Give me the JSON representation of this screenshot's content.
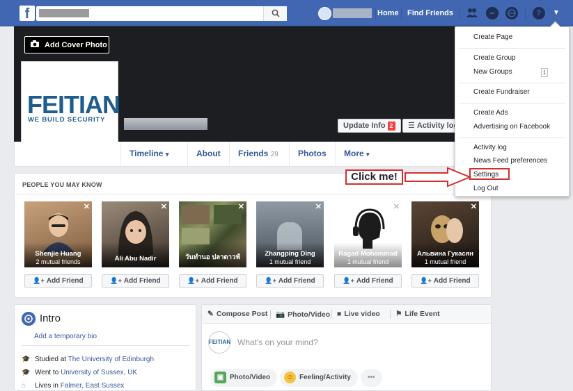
{
  "topbar": {
    "logo": "f",
    "nav_home": "Home",
    "nav_find_friends": "Find Friends",
    "help_icon_label": "?"
  },
  "cover": {
    "add_cover_label": "Add Cover Photo",
    "logo_text": "FEITIAN",
    "logo_tagline": "WE BUILD SECURITY",
    "update_info_label": "Update Info",
    "update_info_badge": "2",
    "activity_log_label": "Activity log"
  },
  "tabs": [
    {
      "label": "Timeline",
      "suffix": "▾"
    },
    {
      "label": "About",
      "suffix": ""
    },
    {
      "label": "Friends",
      "count": "29"
    },
    {
      "label": "Photos",
      "suffix": ""
    },
    {
      "label": "More",
      "suffix": "▾"
    }
  ],
  "pymk": {
    "title": "PEOPLE YOU MAY KNOW",
    "add_friend_label": "Add Friend",
    "people": [
      {
        "name": "Shenjie Huang",
        "mutual": "2 mutual friends",
        "color": "#c9a27c"
      },
      {
        "name": "Ali Abu Nadir",
        "mutual": "",
        "color": "#8d7a6b"
      },
      {
        "name": "วันทำนอ ปลาดาวฟ์",
        "mutual": "",
        "color": "#6f7a55"
      },
      {
        "name": "Zhangping Ding",
        "mutual": "1 mutual friend",
        "color": "#7b8590"
      },
      {
        "name": "Ragad Mohammad",
        "mutual": "1 mutual friend",
        "color": "#ffffff"
      },
      {
        "name": "Альвина Гукасян",
        "mutual": "1 mutual friend",
        "color": "#4a3a2e"
      }
    ]
  },
  "intro": {
    "title": "Intro",
    "bio_link": "Add a temporary bio",
    "rows": [
      {
        "prefix": "Studied at ",
        "link": "The University of Edinburgh"
      },
      {
        "prefix": "Went to ",
        "link": "University of Sussex, UK"
      },
      {
        "prefix": "Lives in ",
        "link": "Falmer, East Sussex"
      }
    ]
  },
  "composer": {
    "tab_compose": "Compose Post",
    "tab_photo": "Photo/Video",
    "tab_live": "Live video",
    "tab_life": "Life Event",
    "avatar_text": "FEITIAN",
    "placeholder": "What's on your mind?",
    "pill_photo": "Photo/Video",
    "pill_feeling": "Feeling/Activity",
    "pill_more": "•••"
  },
  "dropdown": {
    "items": [
      "Create Page",
      "Create Group",
      "New Groups",
      "Create Fundraiser",
      "Create Ads",
      "Advertising on Facebook",
      "Activity log",
      "News Feed preferences",
      "Settings",
      "Log Out"
    ],
    "new_groups_count": "1"
  },
  "callout": {
    "label": "Click me!"
  },
  "colors": {
    "brand": "#4267b2",
    "highlight": "#d12f2f",
    "link": "#365899"
  }
}
